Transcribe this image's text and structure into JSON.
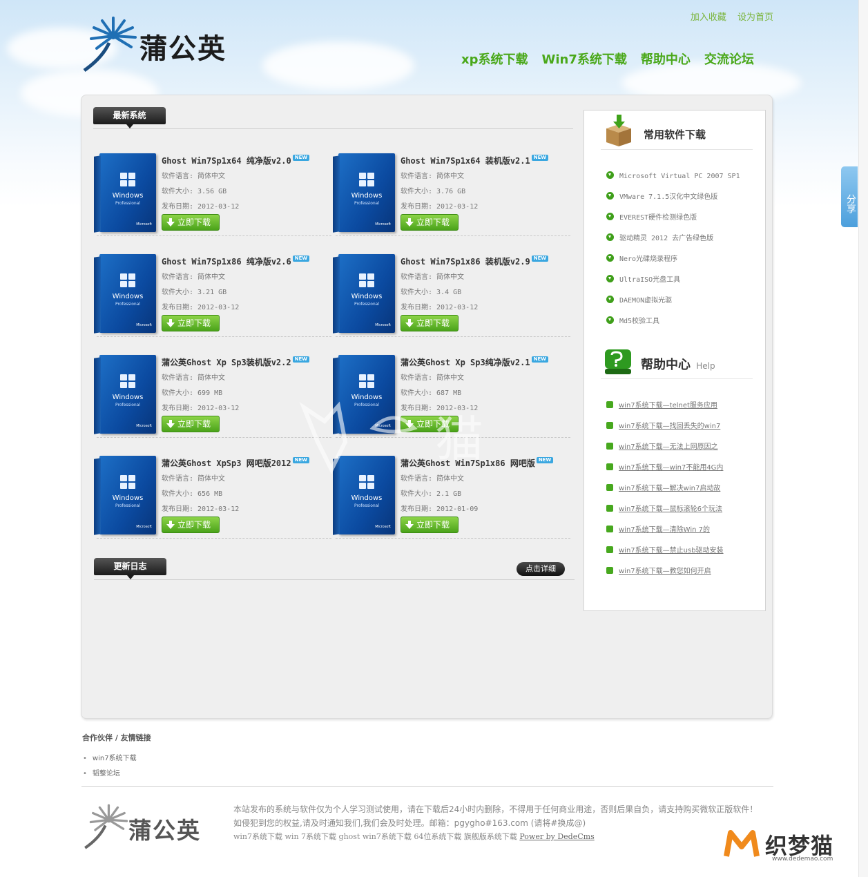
{
  "brand": {
    "name": "蒲公英"
  },
  "toplinks": [
    "加入收藏",
    "设为首页"
  ],
  "nav": [
    "xp系统下载",
    "Win7系统下载",
    "帮助中心",
    "交流论坛"
  ],
  "section_latest": "最新系统",
  "section_log": "更新日志",
  "detail_label": "点击详细",
  "download_label": "立即下载",
  "new_badge": "NEW",
  "box_text": {
    "brand": "Windows",
    "edition": "Professional",
    "maker": "Microsoft"
  },
  "items": [
    {
      "title": "Ghost Win7Sp1x64 纯净版v2.0",
      "lang": "软件语言: 简体中文",
      "size": "软件大小: 3.56 GB",
      "date": "发布日期: 2012-03-12"
    },
    {
      "title": "Ghost Win7Sp1x64 装机版v2.1",
      "lang": "软件语言: 简体中文",
      "size": "软件大小: 3.76 GB",
      "date": "发布日期: 2012-03-12"
    },
    {
      "title": "Ghost Win7Sp1x86 纯净版v2.6",
      "lang": "软件语言: 简体中文",
      "size": "软件大小: 3.21 GB",
      "date": "发布日期: 2012-03-12"
    },
    {
      "title": "Ghost Win7Sp1x86 装机版v2.9",
      "lang": "软件语言: 简体中文",
      "size": "软件大小: 3.4 GB",
      "date": "发布日期: 2012-03-12"
    },
    {
      "title": "蒲公英Ghost Xp Sp3装机版v2.2",
      "lang": "软件语言: 简体中文",
      "size": "软件大小: 699 MB",
      "date": "发布日期: 2012-03-12"
    },
    {
      "title": "蒲公英Ghost Xp Sp3纯净版v2.1",
      "lang": "软件语言: 简体中文",
      "size": "软件大小: 687 MB",
      "date": "发布日期: 2012-03-12"
    },
    {
      "title": "蒲公英Ghost XpSp3 网吧版2012",
      "lang": "软件语言: 简体中文",
      "size": "软件大小: 656 MB",
      "date": "发布日期: 2012-03-12"
    },
    {
      "title": "蒲公英Ghost Win7Sp1x86 网吧版",
      "lang": "软件语言: 简体中文",
      "size": "软件大小: 2.1 GB",
      "date": "发布日期: 2012-01-09"
    }
  ],
  "sidebar": {
    "soft_title": "常用软件下载",
    "soft_items": [
      "Microsoft Virtual PC 2007 SP1",
      "VMware 7.1.5汉化中文绿色版",
      "EVEREST硬件检测绿色版",
      "驱动精灵 2012 去广告绿色版",
      "Nero光碟烧录程序",
      "UltraISO光盘工具",
      "DAEMON虚拟光驱",
      "Md5校验工具"
    ],
    "help_title": "帮助中心",
    "help_sub": "Help",
    "help_items": [
      "win7系统下载—telnet服务应用",
      "win7系统下载—找回丢失的win7",
      "win7系统下载—无法上网原因之",
      "win7系统下载—win7不能用4G内",
      "win7系统下载—解决win7启动故",
      "win7系统下载—鼠标滚轮6个玩法",
      "win7系统下载—清除Win 7的",
      "win7系统下载—禁止usb驱动安装",
      "win7系统下载—教您如何开启"
    ]
  },
  "share": "分享",
  "partners": {
    "title": "合作伙伴 / 友情链接",
    "links": [
      "win7系统下载",
      "韬整论坛"
    ]
  },
  "footer": {
    "line1": "本站发布的系统与软件仅为个人学习测试使用，请在下载后24小时内删除，不得用于任何商业用途，否则后果自负，请支持购买微软正版软件！",
    "line2": "如侵犯到您的权益,请及时通知我们,我们会及时处理。邮箱：pgygho#163.com (请将#换成@)",
    "line3": "win7系统下载 win 7系统下载 ghost win7系统下载 64位系统下载 旗舰版系统下载",
    "power": "Power by DedeCms"
  },
  "dedemao": {
    "name": "织梦猫",
    "url": "www.dedemao.com"
  },
  "watermark": "猫",
  "colors": {
    "nav_green": "#4aa81a",
    "button_green": "#4aa31a",
    "new_blue": "#3aa7e0"
  },
  "icons": [
    "dandelion-logo-icon",
    "download-arrow-icon",
    "box-icon",
    "help-bubble-icon",
    "bullet-download-icon",
    "bullet-square-icon"
  ]
}
